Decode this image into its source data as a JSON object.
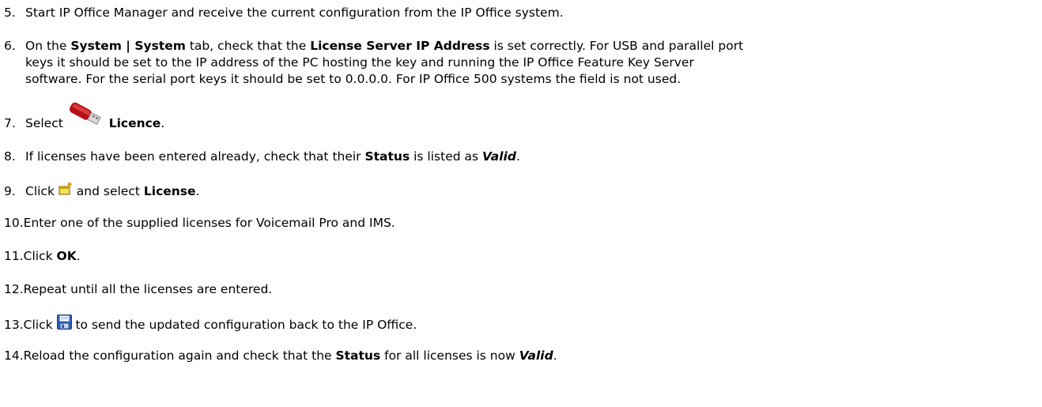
{
  "steps": [
    {
      "num": "5.",
      "text": "Start IP Office Manager and receive the current configuration from the IP Office system."
    },
    {
      "num": "6.",
      "t1": "On the ",
      "b1": "System | System",
      "t2": " tab, check that the ",
      "b2": "License Server IP Address",
      "t3": " is set correctly. For USB and parallel port",
      "line2": "keys it should be set to the IP address of the PC hosting the key and running the IP Office Feature Key Server",
      "line3": "software. For the serial port keys it should be set to 0.0.0.0. For IP Office 500 systems the field is not used."
    },
    {
      "num": "7.",
      "t1": "Select ",
      "icon": "usb-key-icon",
      "b1": "Licence",
      "t2": "."
    },
    {
      "num": "8.",
      "t1": "If licenses have been entered already, check that their ",
      "b1": "Status",
      "t2": " is listed as ",
      "bi1": "Valid",
      "t3": "."
    },
    {
      "num": "9.",
      "t1": "Click ",
      "icon": "new-item-icon",
      "t2": " and select ",
      "b1": "License",
      "t3": "."
    },
    {
      "num": "10.",
      "text": "Enter one of the supplied licenses for Voicemail Pro and IMS."
    },
    {
      "num": "11.",
      "t1": "Click ",
      "b1": "OK",
      "t2": "."
    },
    {
      "num": "12.",
      "text": "Repeat until all the licenses are entered."
    },
    {
      "num": "13.",
      "t1": "Click ",
      "icon": "save-icon",
      "t2": " to send the updated configuration back to the IP Office."
    },
    {
      "num": "14.",
      "t1": "Reload the configuration again and check that the ",
      "b1": "Status",
      "t2": " for all licenses is now ",
      "bi1": "Valid",
      "t3": "."
    }
  ]
}
